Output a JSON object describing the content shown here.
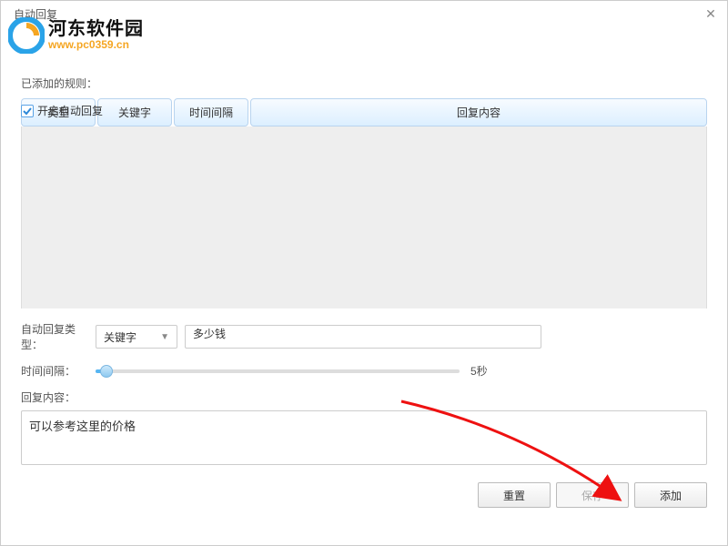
{
  "window": {
    "title": "自动回复"
  },
  "watermark": {
    "cn": "河东软件园",
    "url": "www.pc0359.cn"
  },
  "enable": {
    "label": "开启自动回复",
    "checked": true
  },
  "rules": {
    "label": "已添加的规则：",
    "columns": {
      "type": "类型",
      "keyword": "关键字",
      "interval": "时间间隔",
      "reply": "回复内容"
    }
  },
  "form": {
    "type_label": "自动回复类型：",
    "type_value": "关键字",
    "keyword_value": "多少钱",
    "interval_label": "时间间隔：",
    "interval_display": "5秒",
    "reply_label": "回复内容：",
    "reply_value": "可以参考这里的价格"
  },
  "buttons": {
    "reset": "重置",
    "save": "保存",
    "add": "添加"
  }
}
